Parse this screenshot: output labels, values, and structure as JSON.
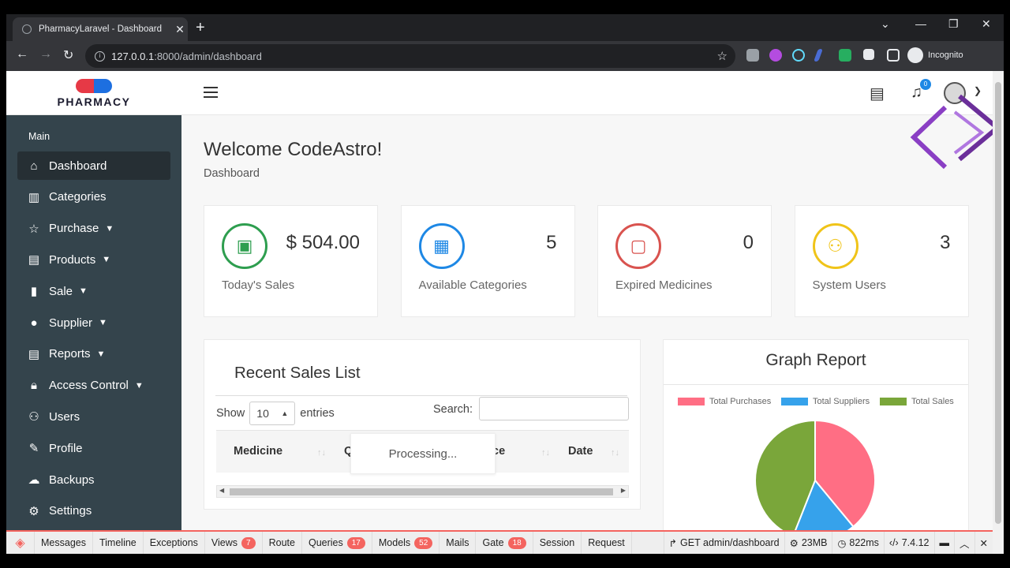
{
  "browser": {
    "tab_title": "PharmacyLaravel - Dashboard",
    "tab_close": "✕",
    "new_tab": "+",
    "url_host": "127.0.0.1",
    "url_path": ":8000/admin/dashboard",
    "profile_label": "Incognito"
  },
  "app": {
    "logo_text": "PHARMACY",
    "notification_count": "0"
  },
  "sidebar": {
    "section_title": "Main",
    "items": [
      {
        "label": "Dashboard",
        "icon": "home-icon",
        "active": true
      },
      {
        "label": "Categories",
        "icon": "columns-icon"
      },
      {
        "label": "Purchase",
        "icon": "star-icon",
        "expandable": true
      },
      {
        "label": "Products",
        "icon": "document-icon",
        "expandable": true
      },
      {
        "label": "Sale",
        "icon": "bar-chart-icon",
        "expandable": true
      },
      {
        "label": "Supplier",
        "icon": "person-icon",
        "expandable": true
      },
      {
        "label": "Reports",
        "icon": "document-icon",
        "expandable": true
      },
      {
        "label": "Access Control",
        "icon": "lock-icon",
        "expandable": true
      },
      {
        "label": "Users",
        "icon": "users-icon"
      },
      {
        "label": "Profile",
        "icon": "user-edit-icon"
      },
      {
        "label": "Backups",
        "icon": "cloud-upload-icon"
      },
      {
        "label": "Settings",
        "icon": "gear-icon"
      }
    ]
  },
  "main": {
    "title": "Welcome CodeAstro!",
    "breadcrumb": "Dashboard"
  },
  "stats": [
    {
      "value": "$ 504.00",
      "label": "Today's Sales",
      "color": "#2e9e4f",
      "icon": "money-icon"
    },
    {
      "value": "5",
      "label": "Available Categories",
      "color": "#1e88e5",
      "icon": "grid-icon"
    },
    {
      "value": "0",
      "label": "Expired Medicines",
      "color": "#d9534f",
      "icon": "folder-icon"
    },
    {
      "value": "3",
      "label": "System Users",
      "color": "#f0c419",
      "icon": "users-icon"
    }
  ],
  "sales": {
    "title": "Recent Sales List",
    "show_label": "Show",
    "page_size": "10",
    "entries_label": "entries",
    "search_label": "Search:",
    "search_value": "",
    "columns": [
      "Medicine",
      "Q",
      "ce",
      "Date"
    ],
    "processing": "Processing..."
  },
  "graph": {
    "title": "Graph Report"
  },
  "chart_data": {
    "type": "pie",
    "title": "Graph Report",
    "labels": [
      "Total Purchases",
      "Total Suppliers",
      "Total Sales"
    ],
    "values": [
      39,
      17,
      44
    ],
    "colors": [
      "#ff6e84",
      "#36a2eb",
      "#7aa63a"
    ],
    "legend_position": "top"
  },
  "debugbar": {
    "tabs": [
      {
        "label": "Messages"
      },
      {
        "label": "Timeline"
      },
      {
        "label": "Exceptions"
      },
      {
        "label": "Views",
        "badge": "7"
      },
      {
        "label": "Route"
      },
      {
        "label": "Queries",
        "badge": "17"
      },
      {
        "label": "Models",
        "badge": "52"
      },
      {
        "label": "Mails"
      },
      {
        "label": "Gate",
        "badge": "18"
      },
      {
        "label": "Session"
      },
      {
        "label": "Request"
      }
    ],
    "request": "GET admin/dashboard",
    "memory": "23MB",
    "time": "822ms",
    "php": "7.4.12"
  }
}
